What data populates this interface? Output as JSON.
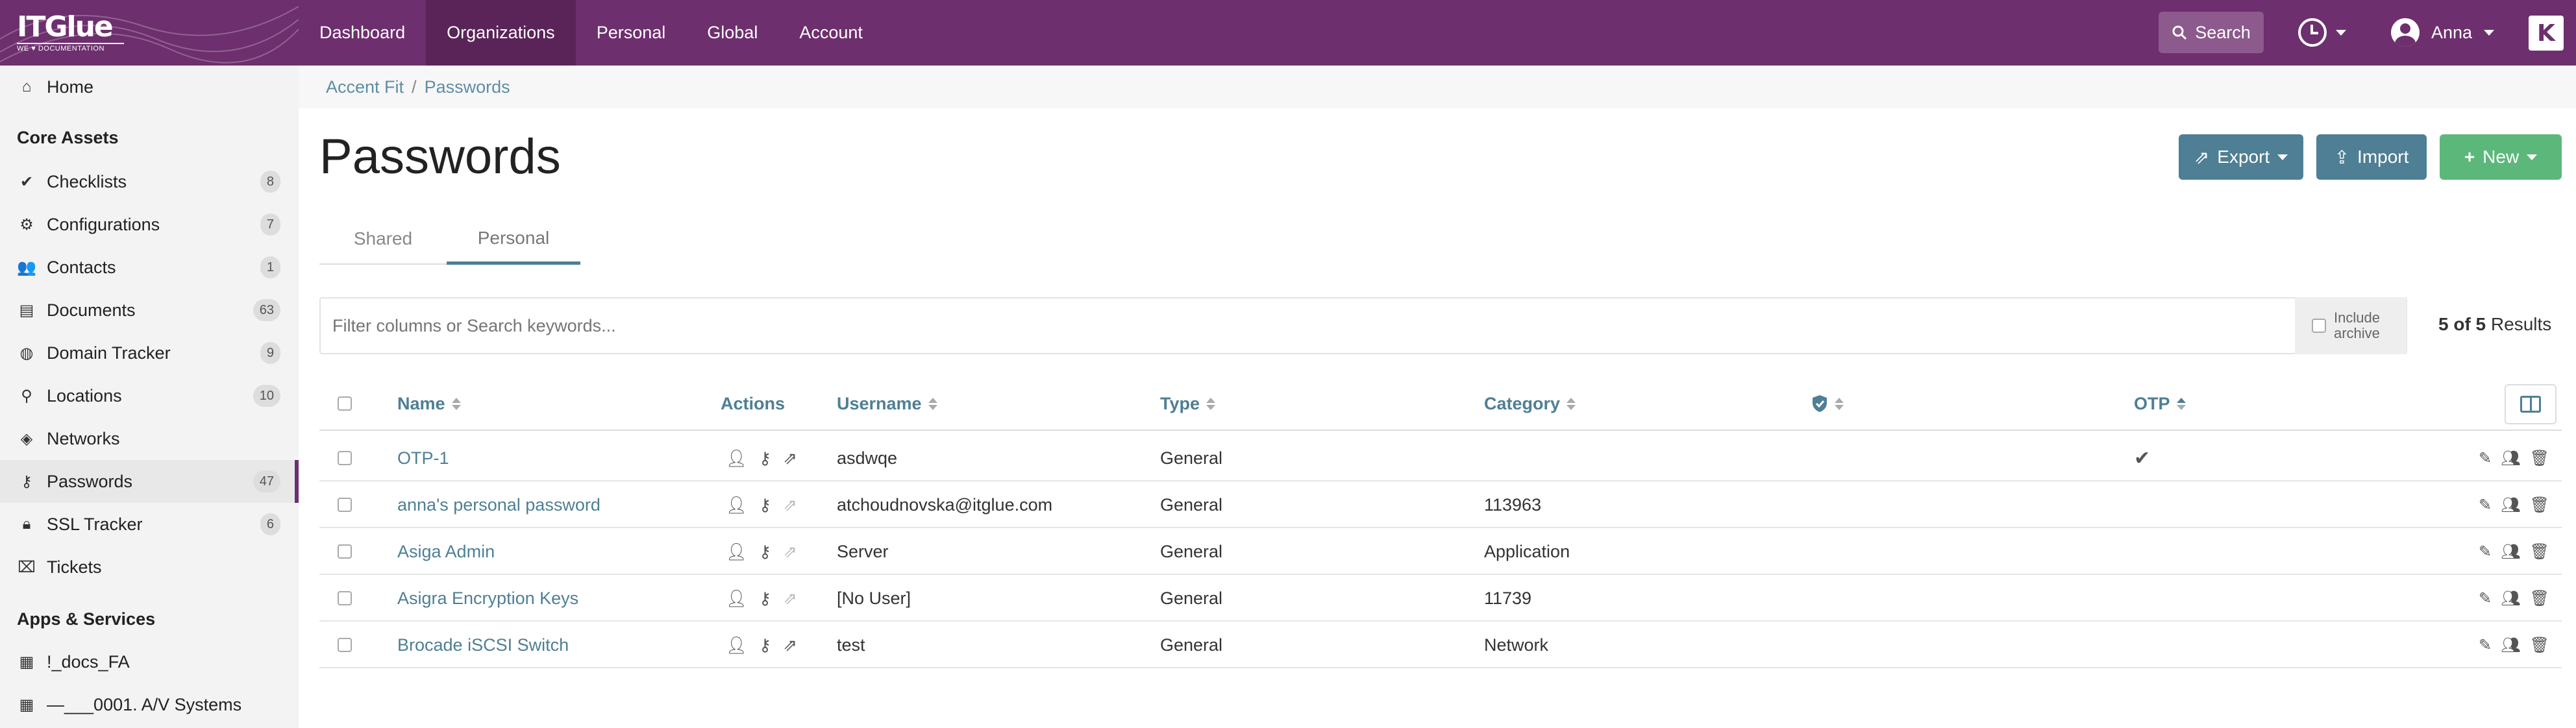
{
  "app": {
    "logo_text": "ITGlue",
    "logo_subtext": "WE ♥ DOCUMENTATION",
    "k_logo": "K"
  },
  "topnav": {
    "items": [
      "Dashboard",
      "Organizations",
      "Personal",
      "Global",
      "Account"
    ],
    "active": "Organizations",
    "search_label": "Search",
    "user_name": "Anna"
  },
  "sidebar": {
    "home": "Home",
    "core_assets_heading": "Core Assets",
    "items": [
      {
        "label": "Checklists",
        "icon": "check-icon",
        "count": "8"
      },
      {
        "label": "Configurations",
        "icon": "gear-icon",
        "count": "7"
      },
      {
        "label": "Contacts",
        "icon": "users-icon",
        "count": "1"
      },
      {
        "label": "Documents",
        "icon": "document-icon",
        "count": "63"
      },
      {
        "label": "Domain Tracker",
        "icon": "globe-icon",
        "count": "9"
      },
      {
        "label": "Locations",
        "icon": "map-pin-icon",
        "count": "10"
      },
      {
        "label": "Networks",
        "icon": "network-icon",
        "count": ""
      },
      {
        "label": "Passwords",
        "icon": "key-icon",
        "count": "47"
      },
      {
        "label": "SSL Tracker",
        "icon": "lock-icon",
        "count": "6"
      },
      {
        "label": "Tickets",
        "icon": "ticket-icon",
        "count": ""
      }
    ],
    "apps_heading": "Apps & Services",
    "apps": [
      {
        "label": "!_docs_FA",
        "icon": "table-icon"
      },
      {
        "label": "—___0001. A/V Systems",
        "icon": "table-icon"
      }
    ]
  },
  "breadcrumb": {
    "org": "Accent Fit",
    "separator": "/",
    "current": "Passwords"
  },
  "page": {
    "title": "Passwords",
    "export_label": "Export",
    "import_label": "Import",
    "new_label": "New",
    "tabs": [
      "Shared",
      "Personal"
    ],
    "active_tab": "Personal",
    "filter_placeholder": "Filter columns or Search keywords...",
    "include_archive_line1": "Include",
    "include_archive_line2": "archive",
    "results_count": "5 of 5",
    "results_label": "Results"
  },
  "table": {
    "columns": [
      "Name",
      "Actions",
      "Username",
      "Type",
      "Category",
      "",
      "OTP"
    ],
    "rows": [
      {
        "name": "OTP-1",
        "username": "asdwqe",
        "type": "General",
        "category": "",
        "otp": true,
        "link_active": true
      },
      {
        "name": "anna's personal password",
        "username": "atchoudnovska@itglue.com",
        "type": "General",
        "category": "113963",
        "otp": false,
        "link_active": false
      },
      {
        "name": "Asiga Admin",
        "username": "Server",
        "type": "General",
        "category": "Application",
        "otp": false,
        "link_active": false
      },
      {
        "name": "Asigra Encryption Keys",
        "username": "[No User]",
        "type": "General",
        "category": "11739",
        "otp": false,
        "link_active": false
      },
      {
        "name": "Brocade iSCSI Switch",
        "username": "test",
        "type": "General",
        "category": "Network",
        "otp": false,
        "link_active": true
      }
    ]
  },
  "colors": {
    "brand_purple": "#6d2f6e",
    "link_teal": "#4e7f94",
    "new_green": "#5cb87a"
  }
}
